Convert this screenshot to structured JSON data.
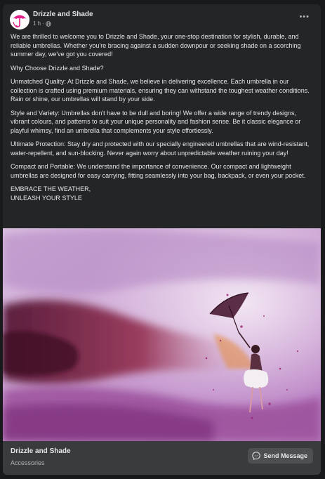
{
  "post": {
    "page_name": "Drizzle and Shade",
    "time": "1 h",
    "dot": "·",
    "more_label": "•••",
    "paragraphs": [
      "We are thrilled to welcome you to Drizzle and Shade, your one-stop destination for stylish, durable, and reliable umbrellas. Whether you're bracing against a sudden downpour or seeking shade on a scorching summer day, we've got you covered!",
      "Why Choose Drizzle and Shade?",
      "Unmatched Quality: At Drizzle and Shade, we believe in delivering excellence. Each umbrella in our collection is crafted using premium materials, ensuring they can withstand the toughest weather conditions. Rain or shine, our umbrellas will stand by your side.",
      "Style and Variety: Umbrellas don't have to be dull and boring! We offer a wide range of trendy designs, vibrant colours, and patterns to suit your unique personality and fashion sense. Be it classic elegance or playful whimsy, find an umbrella that complements your style effortlessly.",
      "Ultimate Protection: Stay dry and protected with our specially engineered umbrellas that are wind-resistant, water-repellent, and sun-blocking. Never again worry about unpredictable weather ruining your day!",
      "Compact and Portable: We understand the importance of convenience. Our compact and lightweight umbrellas are designed for easy carrying, fitting seamlessly into your bag, backpack, or even your pocket."
    ],
    "slogan_line1": "EMBRACE THE WEATHER,",
    "slogan_line2": "UNLEASH YOUR STYLE"
  },
  "footer": {
    "page_name": "Drizzle and Shade",
    "category": "Accessories",
    "send_label": "Send Message"
  },
  "colors": {
    "card_bg": "#242526",
    "page_bg": "#18191a",
    "footer_bg": "#3a3b3c",
    "brand_pink": "#e0218a"
  },
  "icons": {
    "avatar": "umbrella-logo-icon",
    "privacy": "globe-icon",
    "more": "more-options-icon",
    "messenger": "messenger-icon"
  }
}
